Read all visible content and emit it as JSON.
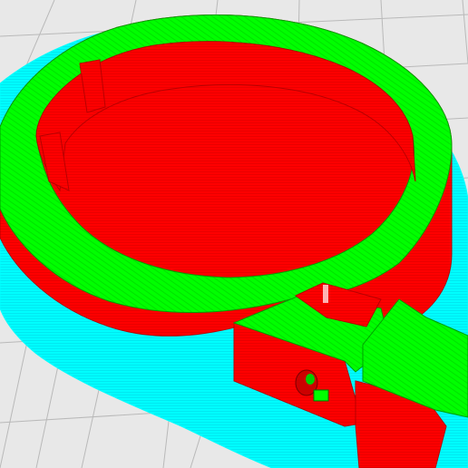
{
  "viewport": {
    "view": "layer-view",
    "colors": {
      "background": "#e8e8e8",
      "grid": "#b9b9b9",
      "skirt": "#00ffff",
      "wall": "#ff0000",
      "infill": "#00ff00"
    },
    "icons": {
      "scene": "3d-layer-preview",
      "object": "clamp-ring-model"
    }
  }
}
